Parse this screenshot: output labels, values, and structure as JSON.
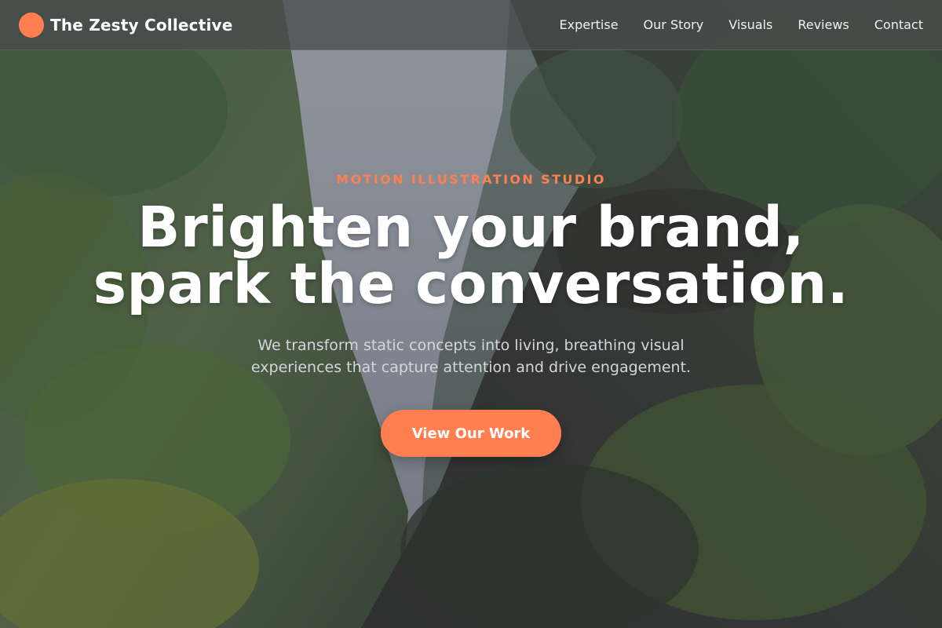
{
  "colors": {
    "accent": "#ff7f50",
    "header_bg": "rgba(70,76,76,0.78)",
    "headline": "#ffffff",
    "subtext": "#d4d6dc"
  },
  "header": {
    "brand_name": "The Zesty Collective",
    "logo_icon": "circle-logo-icon",
    "nav": [
      {
        "label": "Expertise"
      },
      {
        "label": "Our Story"
      },
      {
        "label": "Visuals"
      },
      {
        "label": "Reviews"
      },
      {
        "label": "Contact"
      }
    ]
  },
  "hero": {
    "eyebrow": "MOTION ILLUSTRATION STUDIO",
    "headline_line1": "Brighten your brand,",
    "headline_line2": "spark the conversation.",
    "subtext_line1": "We transform static concepts into living, breathing visual",
    "subtext_line2": "experiences that capture attention and drive engagement.",
    "cta_label": "View Our Work",
    "background": "painted-waterfall-gorge-image"
  }
}
